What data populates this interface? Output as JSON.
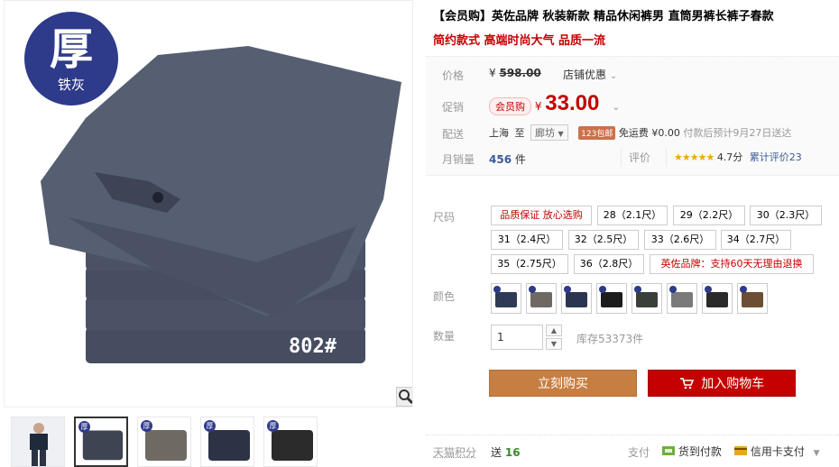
{
  "gallery": {
    "badge_big": "厚",
    "badge_small": "铁灰",
    "model_number": "802#",
    "thumb_badge": "厚",
    "thumb_colors": [
      "#1f2a3a",
      "#3f4452",
      "#6e6a63",
      "#2d3345",
      "#2b2b2b"
    ]
  },
  "product": {
    "title": "【会员购】英佐品牌 秋装新款 精品休闲裤男 直筒男裤长裤子春款",
    "subtitle": "简约款式 高端时尚大气 品质一流"
  },
  "price": {
    "label": "价格",
    "currency": "¥",
    "original": "598.00",
    "shop_discount": "店铺优惠"
  },
  "promo": {
    "label": "促销",
    "member_badge": "会员购",
    "currency": "¥",
    "price": "33.00"
  },
  "shipping": {
    "label": "配送",
    "from": "上海",
    "to_word": "至",
    "dest": "廊坊",
    "tag": "123包邮",
    "free": "免运费",
    "fee": "¥0.00",
    "note": "付款后预计9月27日送达"
  },
  "sales": {
    "label": "月销量",
    "count": "456",
    "unit": "件",
    "rating_label": "评价",
    "stars": "★★★★★",
    "score": "4.7分",
    "review_text": "累计评价23"
  },
  "sizes": {
    "label": "尺码",
    "options": [
      "品质保证 放心选购",
      "28（2.1尺）",
      "29（2.2尺）",
      "30（2.3尺）",
      "31（2.4尺）",
      "32（2.5尺）",
      "33（2.6尺）",
      "34（2.7尺）",
      "35（2.75尺）",
      "36（2.8尺）",
      "英佐品牌：支持60天无理由退换"
    ]
  },
  "colors": {
    "label": "颜色",
    "swatches": [
      "#2f3b55",
      "#6e6a63",
      "#2b3550",
      "#1c1c1c",
      "#3a3f3a",
      "#7a7a7a",
      "#2a2a2a",
      "#6b4e33"
    ]
  },
  "quantity": {
    "label": "数量",
    "value": "1",
    "up": "▲",
    "down": "▼",
    "stock": "库存53373件"
  },
  "actions": {
    "buy": "立刻购买",
    "cart": "加入购物车"
  },
  "footer": {
    "points_label": "天猫积分",
    "points_prefix": "送",
    "points_value": "16",
    "pay_label": "支付",
    "cod": "货到付款",
    "card": "信用卡支付"
  }
}
